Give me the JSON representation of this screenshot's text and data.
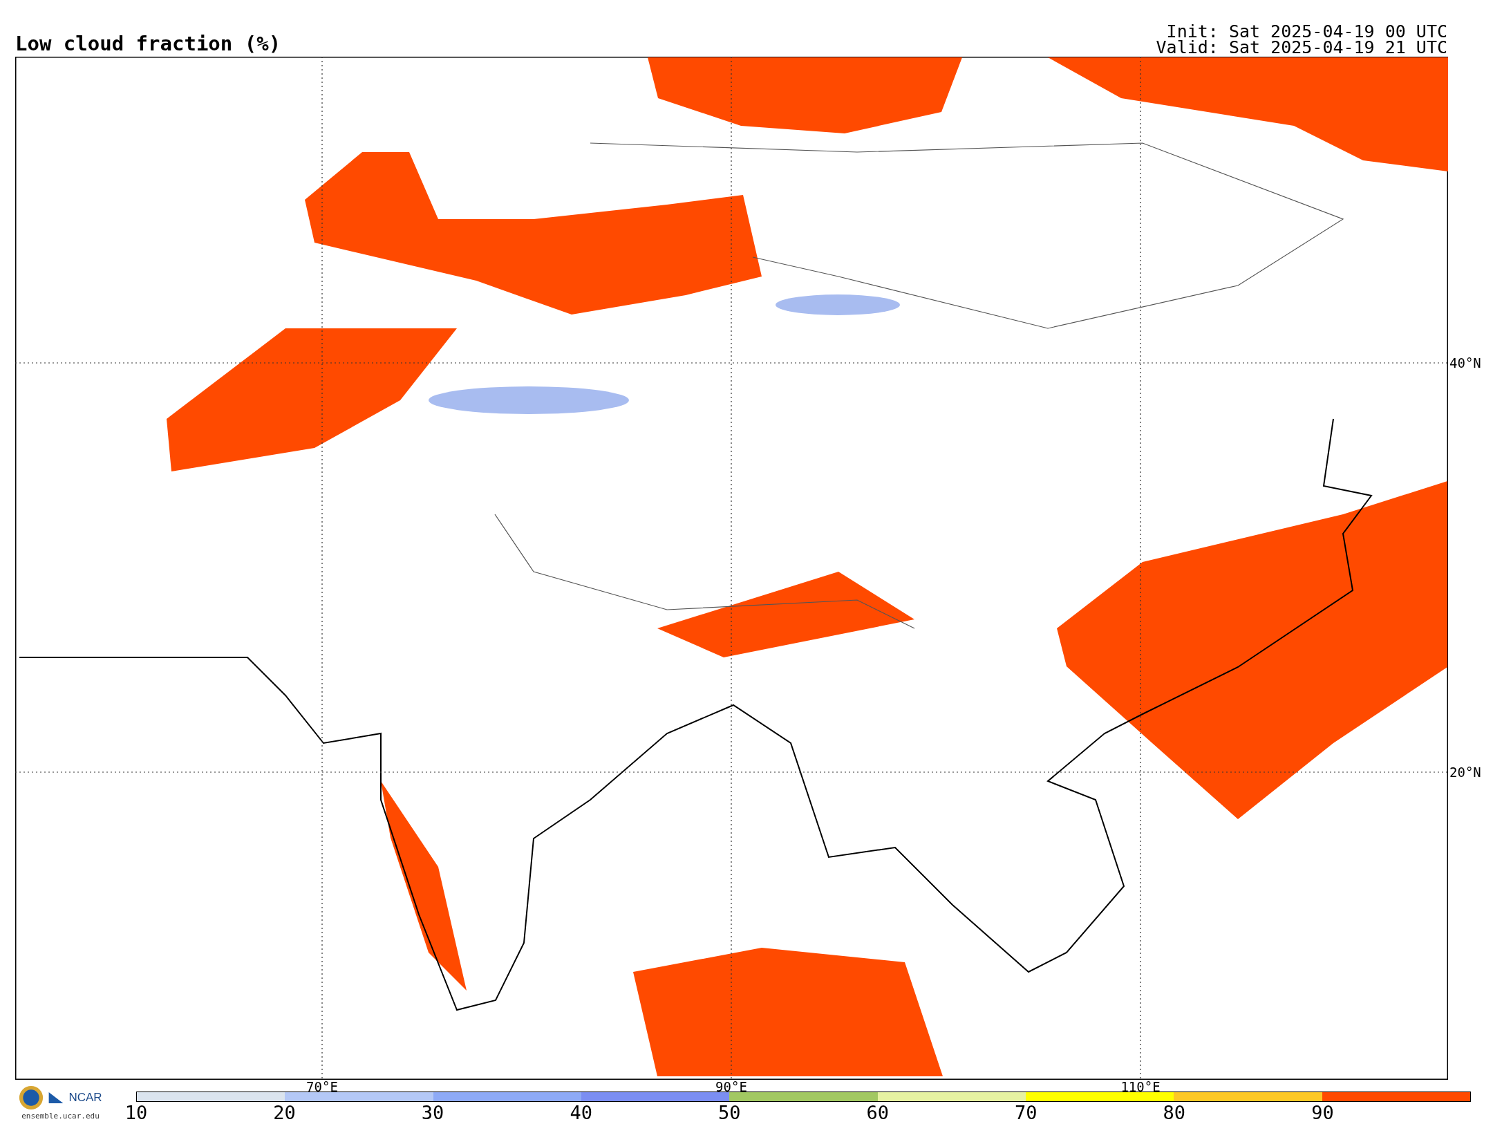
{
  "title": "Low cloud fraction (%)",
  "init": "Init: Sat 2025-04-19 00 UTC",
  "valid": "Valid: Sat 2025-04-19 21 UTC",
  "map": {
    "lat_labels": [
      "40°N",
      "20°N"
    ],
    "lon_labels": [
      "70°E",
      "90°E",
      "110°E"
    ]
  },
  "logo": {
    "text": "NCAR",
    "url": "ensemble.ucar.edu"
  },
  "colorbar": {
    "segments": [
      {
        "color": "#dbe4ee"
      },
      {
        "color": "#b4c8f6"
      },
      {
        "color": "#8eaaf6"
      },
      {
        "color": "#7b8ef2"
      },
      {
        "color": "#a2c862"
      },
      {
        "color": "#e6f2a2"
      },
      {
        "color": "#ffff00"
      },
      {
        "color": "#fdc826"
      },
      {
        "color": "#ff4a00"
      }
    ],
    "ticks": [
      "10",
      "20",
      "30",
      "40",
      "50",
      "60",
      "70",
      "80",
      "90"
    ]
  }
}
